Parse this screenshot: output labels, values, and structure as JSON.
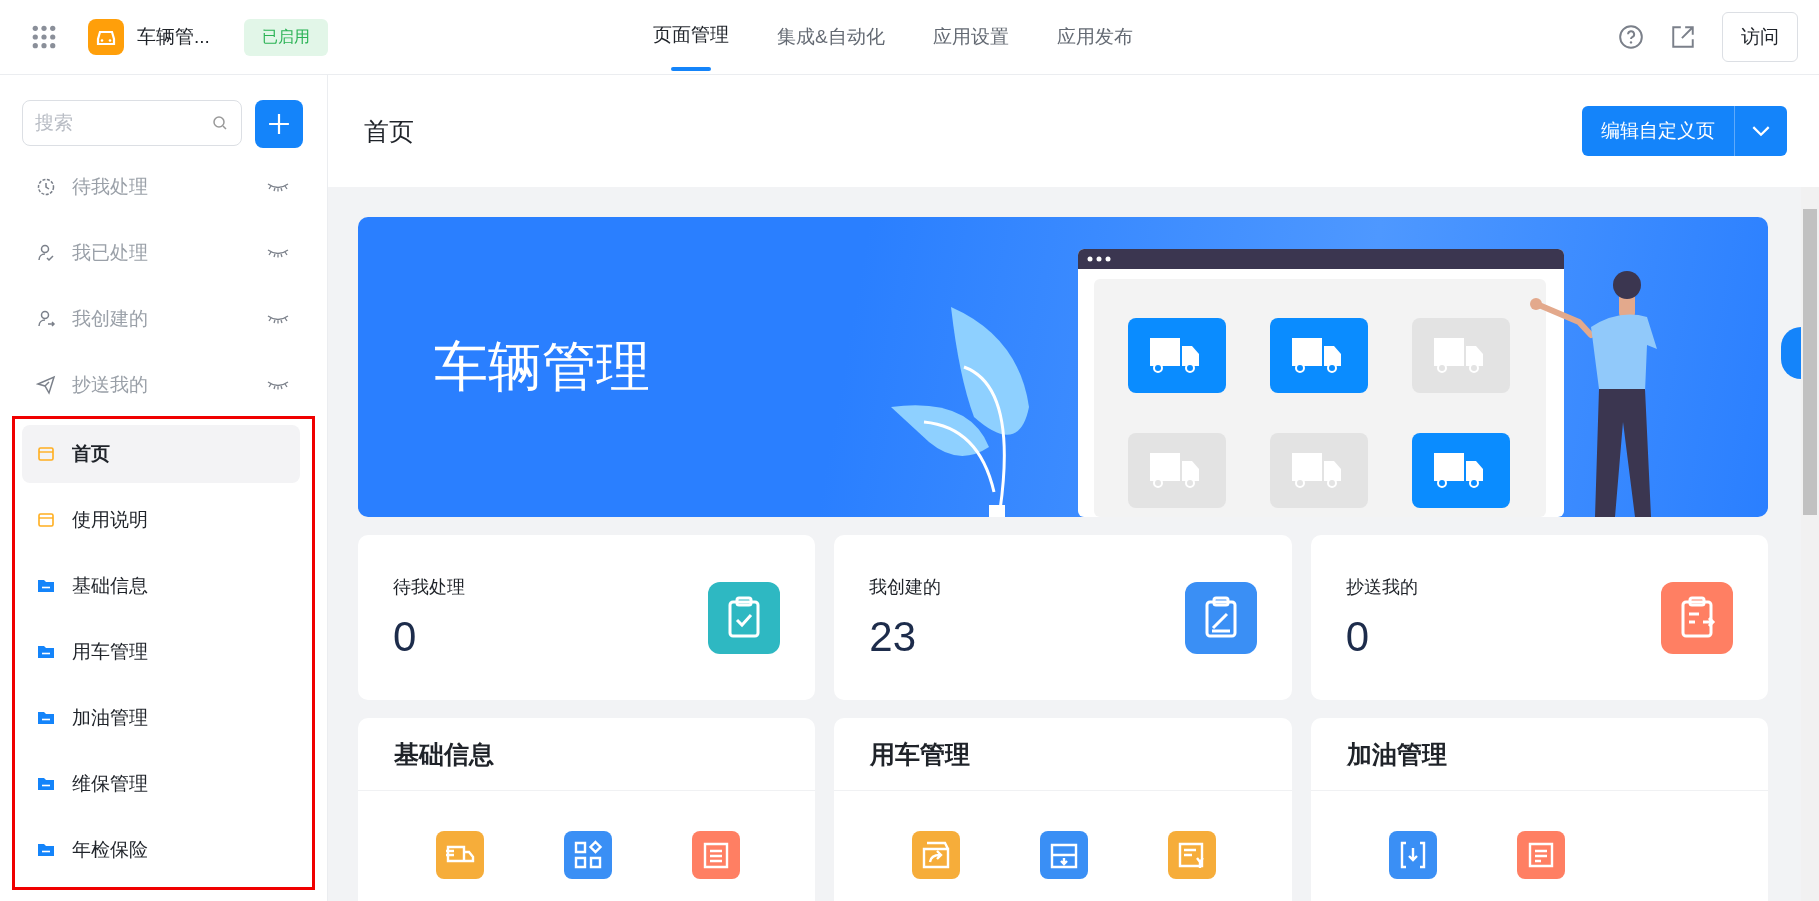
{
  "app_bar": {
    "app_name": "车辆管...",
    "status_badge": "已启用",
    "visit_button": "访问",
    "nav_tabs": [
      {
        "label": "页面管理",
        "selected": true
      },
      {
        "label": "集成&自动化",
        "selected": false
      },
      {
        "label": "应用设置",
        "selected": false
      },
      {
        "label": "应用发布",
        "selected": false
      }
    ]
  },
  "sidebar": {
    "search": {
      "placeholder": "搜索"
    },
    "system_items": [
      {
        "label": "待我处理",
        "kind": "clock",
        "hidden": true
      },
      {
        "label": "我已处理",
        "kind": "user-check",
        "hidden": true
      },
      {
        "label": "我创建的",
        "kind": "user-arrow",
        "hidden": true
      },
      {
        "label": "抄送我的",
        "kind": "send",
        "hidden": true
      }
    ],
    "pages": [
      {
        "label": "首页",
        "kind": "page",
        "selected": true
      },
      {
        "label": "使用说明",
        "kind": "page",
        "selected": false
      },
      {
        "label": "基础信息",
        "kind": "folder",
        "selected": false
      },
      {
        "label": "用车管理",
        "kind": "folder",
        "selected": false
      },
      {
        "label": "加油管理",
        "kind": "folder",
        "selected": false
      },
      {
        "label": "维保管理",
        "kind": "folder",
        "selected": false
      },
      {
        "label": "年检保险",
        "kind": "folder",
        "selected": false
      }
    ]
  },
  "page_header": {
    "title": "首页",
    "edit_button": "编辑自定义页"
  },
  "banner": {
    "title": "车辆管理"
  },
  "stat_cards": [
    {
      "label": "待我处理",
      "value": "0",
      "kind": "clipboard-check",
      "color": "#2eb8c2"
    },
    {
      "label": "我创建的",
      "value": "23",
      "kind": "clipboard-edit",
      "color": "#3a8ff5"
    },
    {
      "label": "抄送我的",
      "value": "0",
      "kind": "clipboard-transfer",
      "color": "#ff7f63"
    }
  ],
  "sections": [
    {
      "title": "基础信息",
      "shortcuts": [
        {
          "kind": "truck",
          "color": "#f6ad3a"
        },
        {
          "kind": "grid",
          "color": "#3a8ff5"
        },
        {
          "kind": "list",
          "color": "#ff7f63"
        }
      ]
    },
    {
      "title": "用车管理",
      "shortcuts": [
        {
          "kind": "share",
          "color": "#f6ad3a"
        },
        {
          "kind": "inbox",
          "color": "#3a8ff5"
        },
        {
          "kind": "invoice",
          "color": "#f6ad3a"
        }
      ]
    },
    {
      "title": "加油管理",
      "shortcuts": [
        {
          "kind": "download",
          "color": "#3a8ff5"
        },
        {
          "kind": "note",
          "color": "#ff7f63"
        }
      ]
    }
  ]
}
